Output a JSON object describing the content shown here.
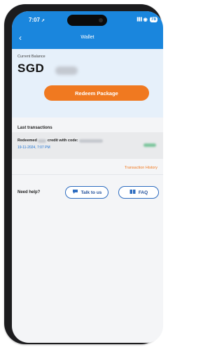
{
  "status_bar": {
    "time": "7:07",
    "time_arrow": "➚",
    "signal": "▐▐▐",
    "wifi": "◉",
    "battery": "78"
  },
  "header": {
    "title": "Wallet",
    "back_glyph": "‹"
  },
  "balance": {
    "label": "Current Balance",
    "currency": "SGD",
    "amount_hidden": true
  },
  "redeem_button": {
    "label": "Redeem Package"
  },
  "transactions": {
    "title": "Last transactions",
    "items": [
      {
        "prefix": "Redeemed",
        "middle": "credit with code:",
        "date": "19-11-2024, 7:07 PM",
        "amount_hidden": true
      }
    ],
    "history_link": "Transaction History"
  },
  "help": {
    "label": "Need help?",
    "talk_label": "Talk to us",
    "talk_icon": "chat-icon",
    "faq_label": "FAQ",
    "faq_icon": "book-icon"
  },
  "colors": {
    "header_blue": "#1a86dd",
    "accent_orange": "#f07920",
    "button_border": "#2d6cc0"
  }
}
